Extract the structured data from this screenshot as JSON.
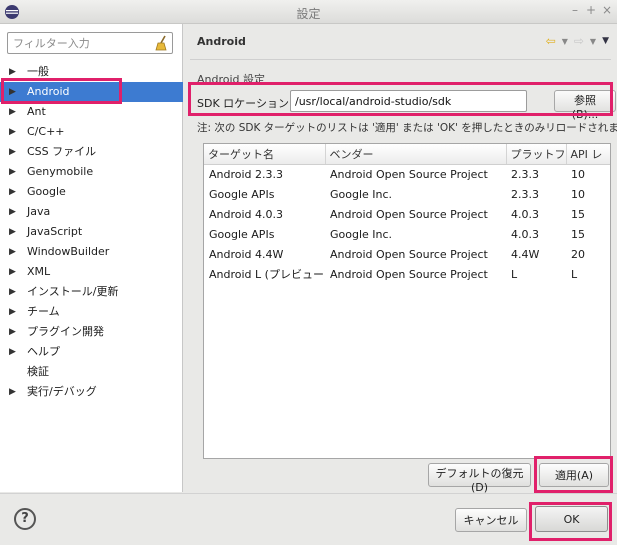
{
  "window": {
    "title": "設定"
  },
  "filter": {
    "placeholder": "フィルター入力"
  },
  "tree": {
    "items": [
      {
        "label": "一般",
        "has_children": true,
        "selected": false
      },
      {
        "label": "Android",
        "has_children": true,
        "selected": true
      },
      {
        "label": "Ant",
        "has_children": true,
        "selected": false
      },
      {
        "label": "C/C++",
        "has_children": true,
        "selected": false
      },
      {
        "label": "CSS ファイル",
        "has_children": true,
        "selected": false
      },
      {
        "label": "Genymobile",
        "has_children": true,
        "selected": false
      },
      {
        "label": "Google",
        "has_children": true,
        "selected": false
      },
      {
        "label": "Java",
        "has_children": true,
        "selected": false
      },
      {
        "label": "JavaScript",
        "has_children": true,
        "selected": false
      },
      {
        "label": "WindowBuilder",
        "has_children": true,
        "selected": false
      },
      {
        "label": "XML",
        "has_children": true,
        "selected": false
      },
      {
        "label": "インストール/更新",
        "has_children": true,
        "selected": false
      },
      {
        "label": "チーム",
        "has_children": true,
        "selected": false
      },
      {
        "label": "プラグイン開発",
        "has_children": true,
        "selected": false
      },
      {
        "label": "ヘルプ",
        "has_children": true,
        "selected": false
      },
      {
        "label": "検証",
        "has_children": false,
        "selected": false
      },
      {
        "label": "実行/デバッグ",
        "has_children": true,
        "selected": false
      }
    ]
  },
  "page": {
    "title": "Android",
    "section_label": "Android 設定",
    "sdk_label": "SDK ロケーション:",
    "sdk_value": "/usr/local/android-studio/sdk",
    "browse_label": "参照(B)...",
    "note": "注: 次の SDK ターゲットのリストは '適用' または 'OK' を押したときのみリロードされます。"
  },
  "table": {
    "columns": [
      "ターゲット名",
      "ベンダー",
      "プラットフォ",
      "API レ"
    ],
    "rows": [
      [
        "Android 2.3.3",
        "Android Open Source Project",
        "2.3.3",
        "10"
      ],
      [
        "Google APIs",
        "Google Inc.",
        "2.3.3",
        "10"
      ],
      [
        "Android 4.0.3",
        "Android Open Source Project",
        "4.0.3",
        "15"
      ],
      [
        "Google APIs",
        "Google Inc.",
        "4.0.3",
        "15"
      ],
      [
        "Android 4.4W",
        "Android Open Source Project",
        "4.4W",
        "20"
      ],
      [
        "Android L (プレビュー)",
        "Android Open Source Project",
        "L",
        "L"
      ]
    ]
  },
  "buttons": {
    "restore_defaults": "デフォルトの復元(D)",
    "apply": "適用(A)",
    "cancel": "キャンセル",
    "ok": "OK",
    "help": "?"
  },
  "colors": {
    "highlight": "#e0206a",
    "selection": "#3d7bd1"
  }
}
